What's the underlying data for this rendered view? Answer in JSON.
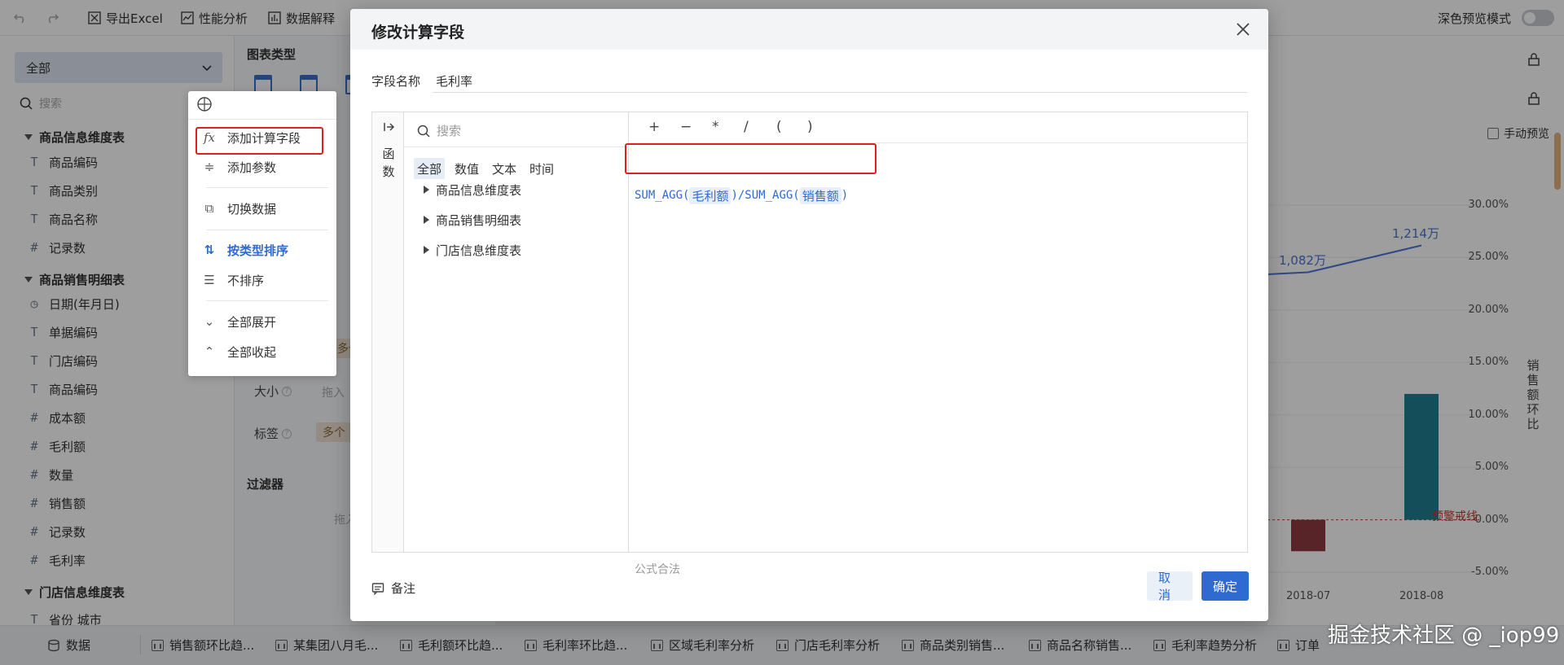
{
  "toolbar": {
    "export_excel": "导出Excel",
    "performance": "性能分析",
    "data_explain": "数据解释",
    "dark_preview": "深色预览模式"
  },
  "left_panel": {
    "select_value": "全部",
    "search_placeholder": "搜索",
    "groups": [
      {
        "name": "商品信息维度表",
        "fields": [
          {
            "icon": "T",
            "name": "商品编码"
          },
          {
            "icon": "T",
            "name": "商品类别"
          },
          {
            "icon": "T",
            "name": "商品名称"
          },
          {
            "icon": "#",
            "name": "记录数"
          }
        ]
      },
      {
        "name": "商品销售明细表",
        "fields": [
          {
            "icon": "clock",
            "name": "日期(年月日)"
          },
          {
            "icon": "T",
            "name": "单据编码"
          },
          {
            "icon": "T",
            "name": "门店编码"
          },
          {
            "icon": "T",
            "name": "商品编码"
          },
          {
            "icon": "#",
            "name": "成本额"
          },
          {
            "icon": "#",
            "name": "毛利额"
          },
          {
            "icon": "#",
            "name": "数量"
          },
          {
            "icon": "#",
            "name": "销售额"
          },
          {
            "icon": "#",
            "name": "记录数"
          },
          {
            "icon": "#",
            "name": "毛利率"
          }
        ]
      },
      {
        "name": "门店信息维度表",
        "fields": [
          {
            "icon": "T",
            "name": "省份 城市"
          }
        ]
      }
    ]
  },
  "middle_panel": {
    "chart_type_title": "图表类型",
    "size_label": "大小",
    "size_hint": "拖入",
    "label_label": "标签",
    "label_pill": "多个",
    "other_pill": "多个",
    "filter_title": "过滤器",
    "filter_hint": "拖入"
  },
  "context_menu": {
    "items": [
      {
        "icon": "fx",
        "label": "添加计算字段"
      },
      {
        "icon": "sliders",
        "label": "添加参数"
      },
      {
        "icon": "switch",
        "label": "切换数据"
      },
      {
        "icon": "sort-type",
        "label": "按类型排序"
      },
      {
        "icon": "no-sort",
        "label": "不排序"
      },
      {
        "icon": "expand",
        "label": "全部展开"
      },
      {
        "icon": "collapse",
        "label": "全部收起"
      }
    ]
  },
  "dialog": {
    "title": "修改计算字段",
    "field_name_label": "字段名称",
    "field_name_value": "毛利率",
    "fn_strip_label": "函数",
    "fn_search_placeholder": "搜索",
    "fn_tabs": [
      "全部",
      "数值",
      "文本",
      "时间"
    ],
    "fn_tree": [
      "商品信息维度表",
      "商品销售明细表",
      "门店信息维度表"
    ],
    "operators": [
      "+",
      "−",
      "*",
      "/",
      "(",
      ")"
    ],
    "formula": {
      "f1": "SUM_AGG(",
      "t1": "毛利额",
      "mid": ")/SUM_AGG(",
      "t2": "销售额",
      "end": ")"
    },
    "formula_status": "公式合法",
    "note_label": "备注",
    "cancel_label": "取消",
    "ok_label": "确定"
  },
  "right_panel": {
    "manual_preview": "手动预览",
    "y_axis_label": "销售额环比",
    "warning_line": "预警戒线"
  },
  "chart_data": {
    "type": "bar",
    "categories": [
      "2018-07",
      "2018-08"
    ],
    "series": [
      {
        "name": "销售额环比",
        "values": [
          -3.0,
          12.0
        ]
      }
    ],
    "line_series": {
      "labels": [
        "1,082万",
        "1,214万"
      ],
      "values": [
        1082,
        1214
      ]
    },
    "y_ticks": [
      "30.00%",
      "25.00%",
      "20.00%",
      "15.00%",
      "10.00%",
      "5.00%",
      "0.00%",
      "-5.00%"
    ],
    "ylim": [
      -5,
      30
    ],
    "bar_colors": [
      "#8e3b40",
      "#1f7f92"
    ],
    "line_color": "#4a74d4"
  },
  "bottom_tabs": {
    "data_tab": "数据",
    "tabs": [
      "销售额环比趋...",
      "某集团八月毛...",
      "毛利额环比趋...",
      "毛利率环比趋...",
      "区域毛利率分析",
      "门店毛利率分析",
      "商品类别销售...",
      "商品名称销售...",
      "毛利率趋势分析",
      "订单"
    ]
  },
  "watermark": "掘金技术社区 @ _iop99"
}
